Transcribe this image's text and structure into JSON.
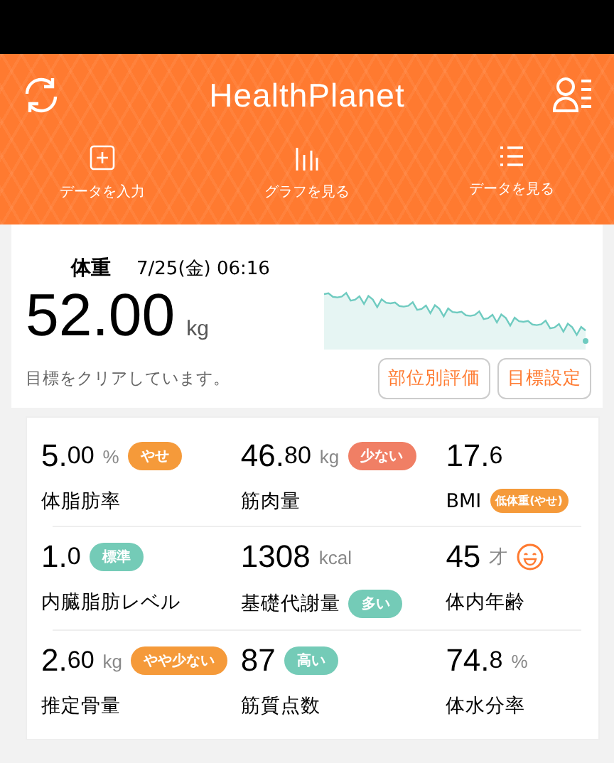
{
  "app_bar": {
    "title": "HealthPlanet"
  },
  "toolbar": [
    {
      "kind": "add",
      "label": "データを入力"
    },
    {
      "kind": "graph",
      "label": "グラフを見る"
    },
    {
      "kind": "list",
      "label": "データを見る"
    }
  ],
  "weight": {
    "label": "体重",
    "date": "7/25(金) 06:16",
    "value": "52.00",
    "unit": "kg",
    "message": "目標をクリアしています。",
    "buttons": [
      "部位別評価",
      "目標設定"
    ]
  },
  "metrics": [
    {
      "kind": "plain",
      "value": "5.",
      "fraction": "00",
      "unit": "%",
      "badge": "やせ",
      "color": "#f59a3a",
      "label": "体脂肪率"
    },
    {
      "kind": "plain",
      "value": "46.",
      "fraction": "80",
      "unit": "kg",
      "badge": "少ない",
      "color": "#f07f65",
      "label": "筋肉量"
    },
    {
      "kind": "plain",
      "value": "17.",
      "fraction": "6",
      "label_badge": "低体重(やせ)",
      "color": "#f59a3a",
      "label": "BMI"
    },
    {
      "kind": "plain",
      "value": "1.",
      "fraction": "0",
      "badge": "標準",
      "color": "#74cbb7",
      "label": "内臓脂肪レベル"
    },
    {
      "kind": "plain",
      "value": "1308",
      "unit": "kcal",
      "label_badge": "多い",
      "color": "#74cbb7",
      "label": "基礎代謝量"
    },
    {
      "kind": "face",
      "value": "45",
      "unit": "才",
      "label": "体内年齢"
    },
    {
      "kind": "plain",
      "value": "2.",
      "fraction": "60",
      "unit": "kg",
      "badge": "やや少ない",
      "color": "#f59a3a",
      "label": "推定骨量"
    },
    {
      "kind": "plain",
      "value": "87",
      "badge": "高い",
      "color": "#74cbb7",
      "label": "筋質点数"
    },
    {
      "kind": "plain",
      "value": "74.",
      "fraction": "8",
      "unit": "%",
      "label": "体水分率"
    }
  ]
}
